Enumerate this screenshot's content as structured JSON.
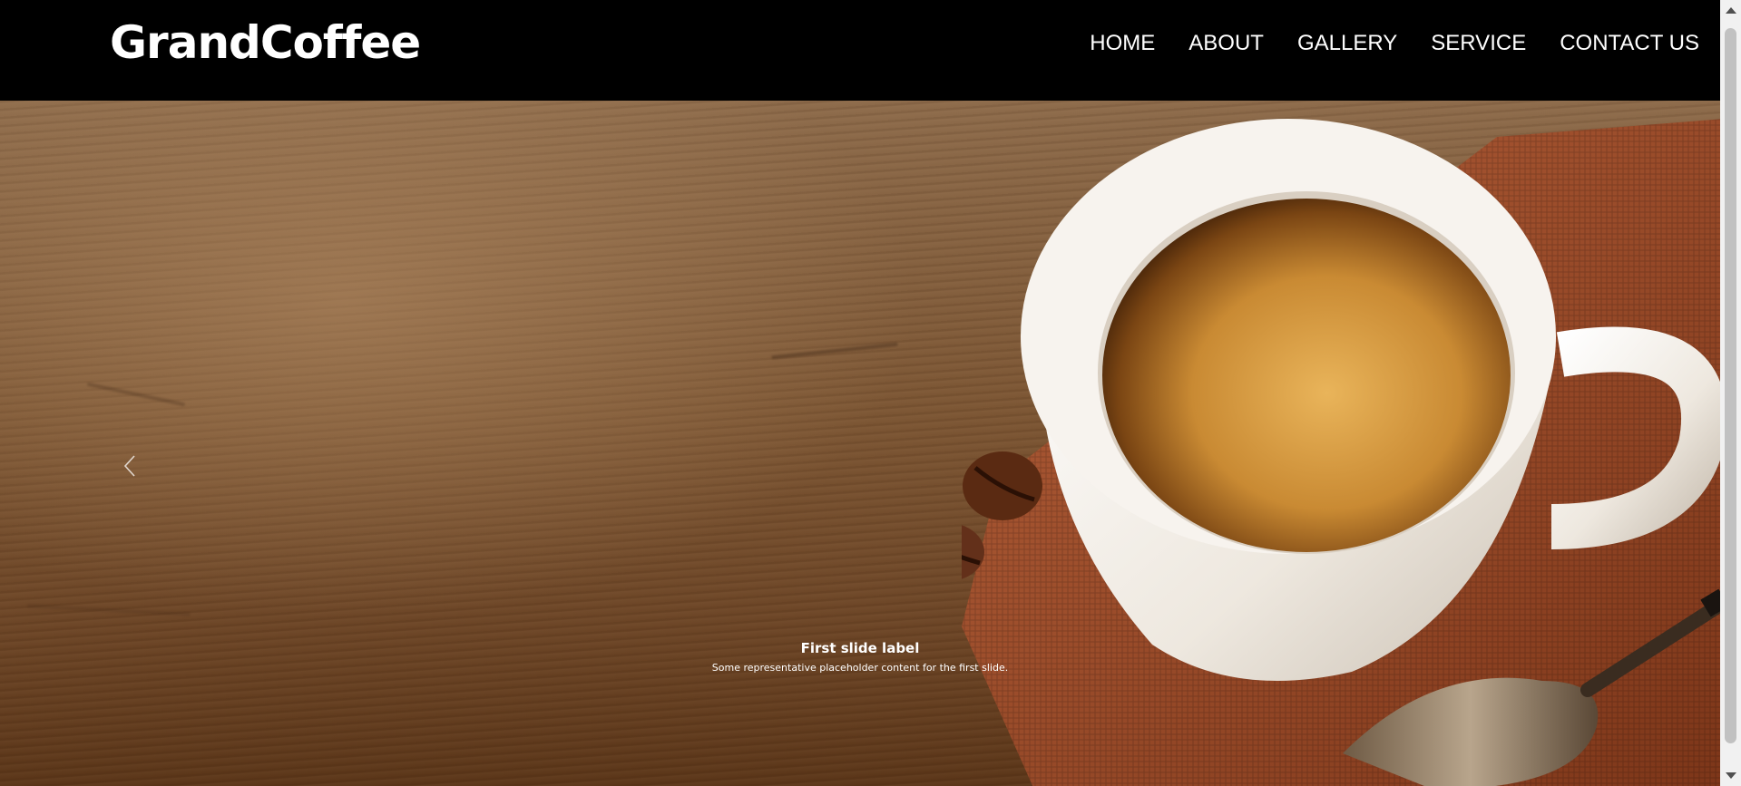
{
  "header": {
    "brand": "GrandCoffee",
    "nav": [
      {
        "label": "HOME"
      },
      {
        "label": "ABOUT"
      },
      {
        "label": "GALLERY"
      },
      {
        "label": "SERVICE"
      },
      {
        "label": "CONTACT US"
      }
    ]
  },
  "carousel": {
    "caption_title": "First slide label",
    "caption_text": "Some representative placeholder content for the first slide.",
    "prev_icon": "chevron-left-icon"
  },
  "colors": {
    "navbar_bg": "#000000",
    "nav_text": "#ffffff"
  }
}
